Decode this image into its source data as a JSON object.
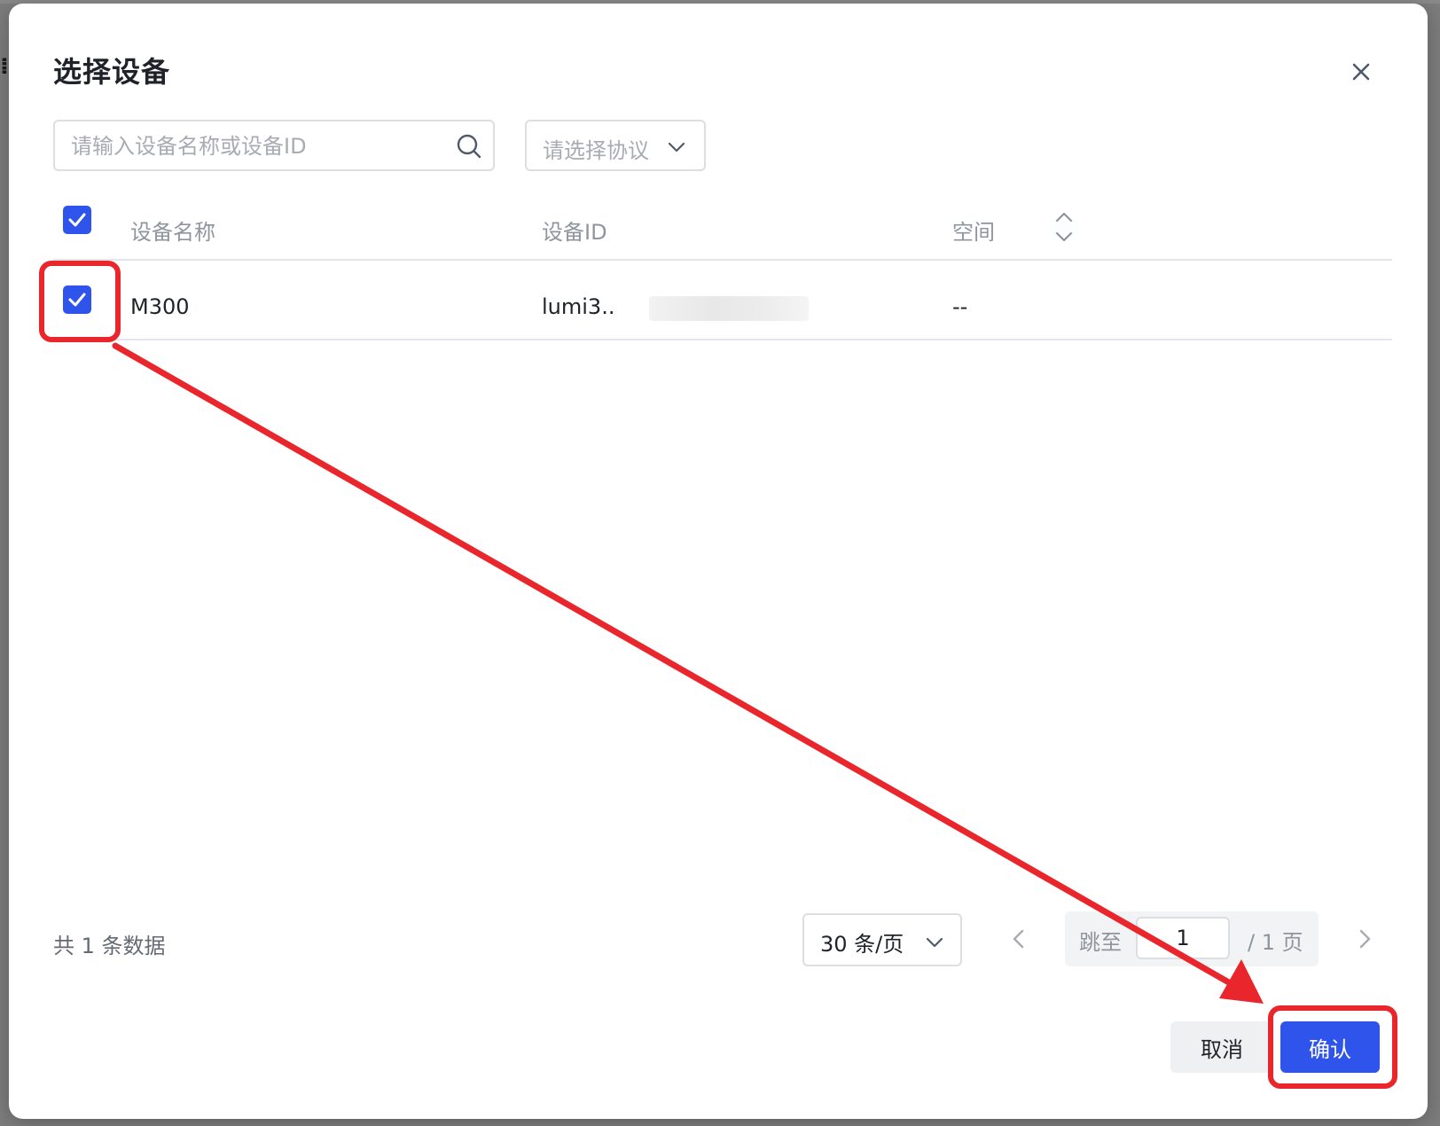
{
  "dialog": {
    "title": "选择设备",
    "close_icon": "close-icon"
  },
  "search": {
    "placeholder": "请输入设备名称或设备ID",
    "value": "",
    "icon": "search-icon"
  },
  "protocol_select": {
    "placeholder": "请选择协议",
    "icon": "chevron-down-icon"
  },
  "table": {
    "header_checkbox_checked": true,
    "columns": [
      "设备名称",
      "设备ID",
      "空间"
    ],
    "sort_icon": "sort-icon",
    "rows": [
      {
        "checked": true,
        "name": "M300",
        "device_id": "lumi3..",
        "space": "--"
      }
    ]
  },
  "pagination": {
    "total": "共 1 条数据",
    "page_size": "30 条/页",
    "jump_label": "跳至",
    "jump_value": "1",
    "page_suffix": "/ 1 页"
  },
  "footer": {
    "cancel_label": "取消",
    "confirm_label": "确认"
  },
  "colors": {
    "primary": "#2f54eb",
    "annotation": "#e8262b"
  }
}
